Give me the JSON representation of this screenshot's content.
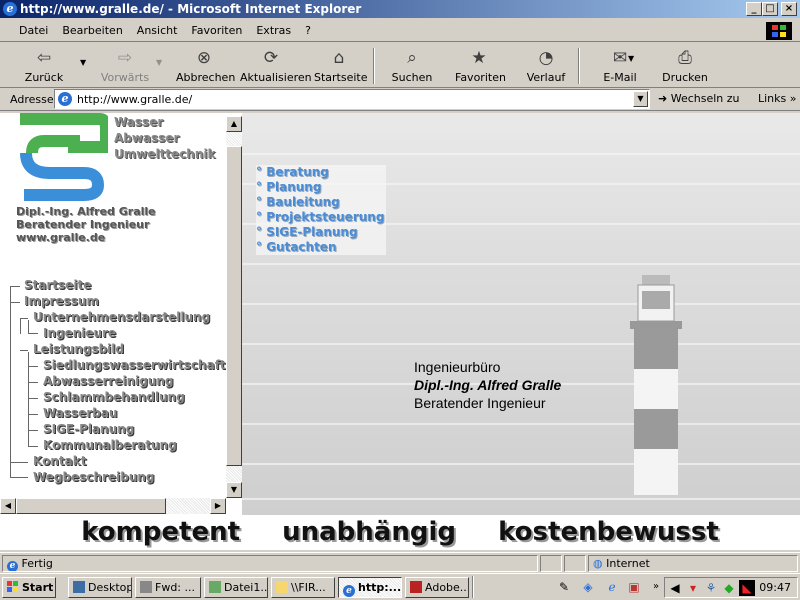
{
  "window": {
    "title": "http://www.gralle.de/ - Microsoft Internet Explorer"
  },
  "menu": [
    "Datei",
    "Bearbeiten",
    "Ansicht",
    "Favoriten",
    "Extras",
    "?"
  ],
  "toolbar": {
    "back": "Zurück",
    "forward": "Vorwärts",
    "stop": "Abbrechen",
    "refresh": "Aktualisieren",
    "home": "Startseite",
    "search": "Suchen",
    "favorites": "Favoriten",
    "history": "Verlauf",
    "mail": "E-Mail",
    "print": "Drucken"
  },
  "address": {
    "label": "Adresse",
    "url": "http://www.gralle.de/",
    "go": "Wechseln zu",
    "links": "Links"
  },
  "site": {
    "brand": [
      "Wasser",
      "Abwasser",
      "Umwelttechnik"
    ],
    "owner": [
      "Dipl.-Ing. Alfred Gralle",
      "Beratender Ingenieur",
      "www.gralle.de"
    ],
    "nav": [
      "Startseite",
      "Impressum",
      "Unternehmensdarstellung",
      "Ingenieure",
      "Leistungsbild",
      "Siedlungswasserwirtschaft",
      "Abwasserreinigung",
      "Schlammbehandlung",
      "Wasserbau",
      "SIGE-Planung",
      "Kommunalberatung",
      "Kontakt",
      "Wegbeschreibung"
    ],
    "services": [
      "Beratung",
      "Planung",
      "Bauleitung",
      "Projektsteuerung",
      "SIGE-Planung",
      "Gutachten"
    ],
    "info": [
      "Ingenieurbüro",
      "Dipl.-Ing. Alfred Gralle",
      "Beratender Ingenieur"
    ],
    "slogan": "kompetent  unabhängig  kostenbewusst"
  },
  "status": {
    "text": "Fertig",
    "zone": "Internet"
  },
  "taskbar": {
    "start": "Start",
    "tasks": [
      "Desktop",
      "Fwd: ...",
      "Datei1...",
      "\\\\FIR...",
      "http:...",
      "Adobe..."
    ],
    "clock": "09:47"
  },
  "colors": {
    "titlebar": "#0a246a",
    "serviceLinks": "#4a8cd6",
    "logoBlue": "#3b8fd9",
    "logoGreen": "#4caf50"
  }
}
